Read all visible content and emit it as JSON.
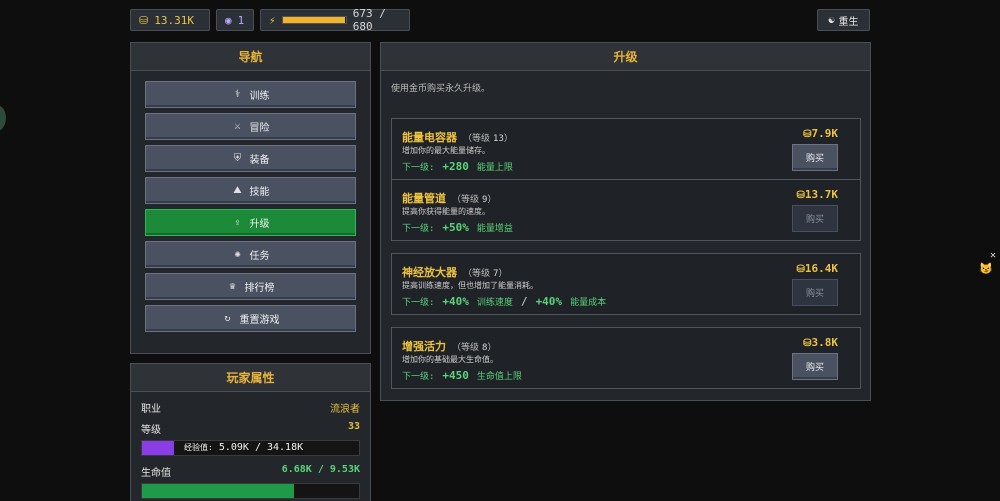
{
  "topbar": {
    "gold": "13.31K",
    "gems": "1",
    "energy_text": "673 / 680",
    "energy_fraction": 0.9897,
    "rebirth_label": "重生"
  },
  "nav": {
    "title": "导航",
    "items": [
      {
        "label": "训练",
        "icon": "dumbbell-icon",
        "glyph": "⚕"
      },
      {
        "label": "冒险",
        "icon": "crossed-swords-icon",
        "glyph": "⚔"
      },
      {
        "label": "装备",
        "icon": "armor-icon",
        "glyph": "⛨"
      },
      {
        "label": "技能",
        "icon": "skill-icon",
        "glyph": "⛰"
      },
      {
        "label": "升级",
        "icon": "upgrade-icon",
        "glyph": "⇪"
      },
      {
        "label": "任务",
        "icon": "quest-icon",
        "glyph": "✺"
      },
      {
        "label": "排行榜",
        "icon": "trophy-icon",
        "glyph": "♛"
      },
      {
        "label": "重置游戏",
        "icon": "reset-icon",
        "glyph": "↻"
      }
    ],
    "active_index": 4
  },
  "stats": {
    "title": "玩家属性",
    "class_label": "职业",
    "class_value": "流浪者",
    "level_label": "等级",
    "level_value": "33",
    "xp_label": "经验值:",
    "xp_text": "5.09K / 34.18K",
    "xp_fraction": 0.149,
    "hp_label": "生命值",
    "hp_text": "6.68K / 9.53K",
    "hp_fraction": 0.701,
    "colors": {
      "xp": "#8a3ce6",
      "hp": "#1f9a49"
    }
  },
  "upgrades": {
    "title": "升级",
    "description": "使用金币购买永久升级。",
    "level_word": "等级",
    "next_word": "下一级:",
    "buy_label": "购买",
    "items": [
      {
        "name": "能量电容器",
        "level": "13",
        "desc": "增加你的最大能量储存。",
        "bonus": "+280",
        "bonus_label": "能量上限",
        "bonus2": "",
        "bonus2_label": "",
        "cost": "7.9K",
        "affordable": true
      },
      {
        "name": "能量管道",
        "level": "9",
        "desc": "提高你获得能量的速度。",
        "bonus": "+50%",
        "bonus_label": "能量增益",
        "bonus2": "",
        "bonus2_label": "",
        "cost": "13.7K",
        "affordable": false
      },
      {
        "name": "神经放大器",
        "level": "7",
        "desc": "提高训练速度，但也增加了能量消耗。",
        "bonus": "+40%",
        "bonus_label": "训练速度",
        "bonus2": "+40%",
        "bonus2_label": "能量成本",
        "cost": "16.4K",
        "affordable": false
      },
      {
        "name": "增强活力",
        "level": "8",
        "desc": "增加你的基础最大生命值。",
        "bonus": "+450",
        "bonus_label": "生命值上限",
        "bonus2": "",
        "bonus2_label": "",
        "cost": "3.8K",
        "affordable": true
      }
    ]
  }
}
